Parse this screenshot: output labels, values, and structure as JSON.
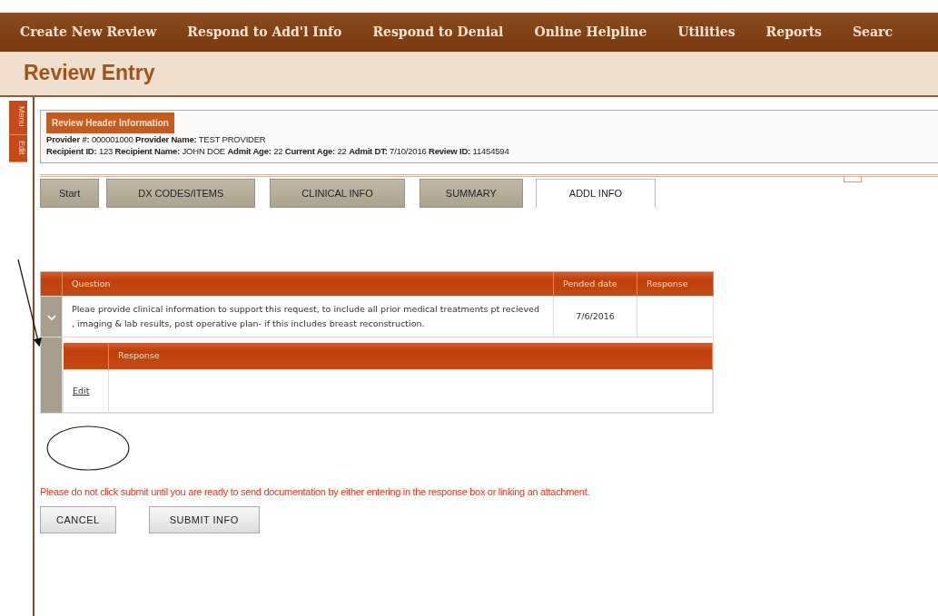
{
  "nav": {
    "items": [
      "Create New Review",
      "Respond to Add'l Info",
      "Respond to Denial",
      "Online Helpline",
      "Utilities",
      "Reports",
      "Searc"
    ]
  },
  "page_title": "Review Entry",
  "side_tabs": [
    "Menu",
    "Edit"
  ],
  "header": {
    "legend": "Review Header Information",
    "lines": [
      "**Provider #:** 000001000 **Provider Name:** TEST PROVIDER",
      "**Recipient ID:** 123 **Recipient Name:** JOHN DOE **Admit Age:** 22 **Current Age:** 22 **Admit DT:** 7/10/2016 **Review ID:** 11454594"
    ]
  },
  "tabs": [
    {
      "label": "Start",
      "selected": false
    },
    {
      "label": "DX CODES/ITEMS",
      "selected": false
    },
    {
      "label": "CLINICAL INFO",
      "selected": false
    },
    {
      "label": "SUMMARY",
      "selected": false
    },
    {
      "label": "ADDL INFO",
      "selected": true
    }
  ],
  "table": {
    "columns": [
      "Question",
      "Pended date",
      "Response"
    ],
    "rows": [
      {
        "expanded": true,
        "question": "Pleae provide clinical information to support this request, to include all prior medical treatments pt recieved , imaging & lab results, post operative plan- if this includes breast reconstruction.",
        "pended_date": "7/6/2016",
        "detail": {
          "columns": [
            "Response"
          ],
          "rows": [
            {
              "action": "Edit"
            }
          ]
        }
      }
    ]
  },
  "warning": "Please do not click submit until you are ready to send documentation by either entering in the response box or linking an attachment.",
  "buttons": [
    "CANCEL",
    "SUBMIT INFO"
  ]
}
